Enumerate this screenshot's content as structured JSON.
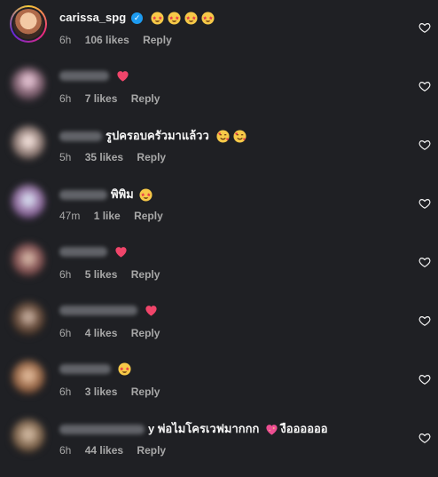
{
  "colors": {
    "background": "#1f2024",
    "text": "#f5f5f5",
    "meta": "#a8a8a8",
    "heart_emoji": "#f0456a",
    "verified": "#1d9bf0"
  },
  "comments": [
    {
      "username": "carissa_spg",
      "verified": true,
      "text": "",
      "emojis": [
        "star-struck",
        "star-struck",
        "star-struck",
        "star-struck"
      ],
      "time": "6h",
      "likes": "106 likes",
      "reply": "Reply"
    },
    {
      "username": "",
      "verified": false,
      "text": "",
      "emojis": [
        "heart"
      ],
      "time": "6h",
      "likes": "7 likes",
      "reply": "Reply"
    },
    {
      "username": "",
      "verified": false,
      "text": "รูปครอบครัวมาแล้วว",
      "emojis": [
        "smiling-hearts",
        "smiling-hearts"
      ],
      "time": "5h",
      "likes": "35 likes",
      "reply": "Reply"
    },
    {
      "username": "",
      "verified": false,
      "text": "พิพิม",
      "emojis": [
        "star-struck"
      ],
      "time": "47m",
      "likes": "1 like",
      "reply": "Reply"
    },
    {
      "username": "",
      "verified": false,
      "text": "",
      "emojis": [
        "heart"
      ],
      "time": "6h",
      "likes": "5 likes",
      "reply": "Reply"
    },
    {
      "username": "",
      "verified": false,
      "text": "",
      "emojis": [
        "heart"
      ],
      "time": "6h",
      "likes": "4 likes",
      "reply": "Reply"
    },
    {
      "username": "",
      "verified": false,
      "text": "",
      "emojis": [
        "star-struck"
      ],
      "time": "6h",
      "likes": "3 likes",
      "reply": "Reply"
    },
    {
      "username": "",
      "verified": false,
      "text": "y พ่อไมโครเวฟมากกก",
      "emojis": [
        "sparkling-heart"
      ],
      "text_after": "งืออออออ",
      "time": "6h",
      "likes": "44 likes",
      "reply": "Reply"
    }
  ]
}
